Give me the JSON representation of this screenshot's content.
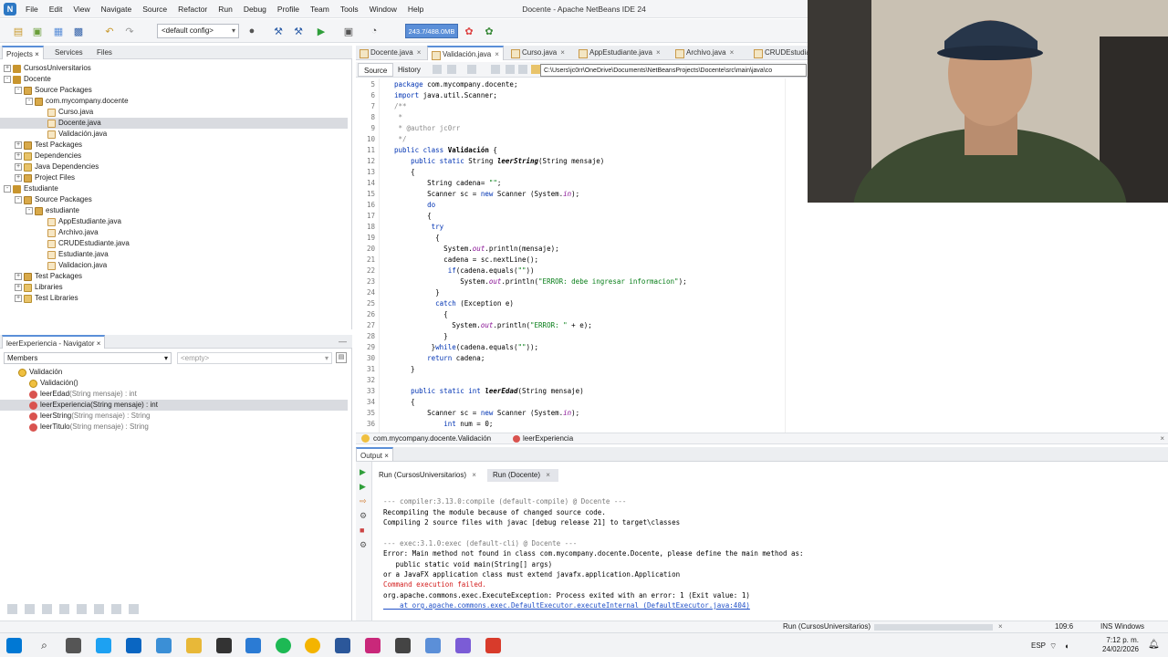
{
  "window": {
    "title": "Docente - Apache NetBeans IDE 24",
    "menu": [
      "File",
      "Edit",
      "View",
      "Navigate",
      "Source",
      "Refactor",
      "Run",
      "Debug",
      "Profile",
      "Team",
      "Tools",
      "Window",
      "Help"
    ]
  },
  "toolbar": {
    "config": "<default config>",
    "memory": "243.7/488.0MB"
  },
  "projects_panel": {
    "tabs": [
      "Projects",
      "Services",
      "Files"
    ],
    "tree": [
      {
        "label": "CursosUniversitarios",
        "level": 0,
        "icon": "project-icon"
      },
      {
        "label": "Docente",
        "level": 0,
        "icon": "project-icon"
      },
      {
        "label": "Source Packages",
        "level": 1,
        "icon": "package-folder-icon"
      },
      {
        "label": "com.mycompany.docente",
        "level": 2,
        "icon": "package-icon"
      },
      {
        "label": "Curso.java",
        "level": 3,
        "icon": "java-file-icon"
      },
      {
        "label": "Docente.java",
        "level": 3,
        "icon": "java-file-icon",
        "selected": true
      },
      {
        "label": "Validación.java",
        "level": 3,
        "icon": "java-file-icon"
      },
      {
        "label": "Test Packages",
        "level": 1,
        "icon": "package-folder-icon"
      },
      {
        "label": "Dependencies",
        "level": 1,
        "icon": "library-icon"
      },
      {
        "label": "Java Dependencies",
        "level": 1,
        "icon": "library-icon"
      },
      {
        "label": "Project Files",
        "level": 1,
        "icon": "folder-icon"
      },
      {
        "label": "Estudiante",
        "level": 0,
        "icon": "project-icon"
      },
      {
        "label": "Source Packages",
        "level": 1,
        "icon": "package-folder-icon"
      },
      {
        "label": "estudiante",
        "level": 2,
        "icon": "package-icon"
      },
      {
        "label": "AppEstudiante.java",
        "level": 3,
        "icon": "java-file-icon"
      },
      {
        "label": "Archivo.java",
        "level": 3,
        "icon": "java-file-icon"
      },
      {
        "label": "CRUDEstudiante.java",
        "level": 3,
        "icon": "java-file-icon"
      },
      {
        "label": "Estudiante.java",
        "level": 3,
        "icon": "java-file-icon"
      },
      {
        "label": "Validacion.java",
        "level": 3,
        "icon": "java-file-icon"
      },
      {
        "label": "Test Packages",
        "level": 1,
        "icon": "package-folder-icon"
      },
      {
        "label": "Libraries",
        "level": 1,
        "icon": "library-icon"
      },
      {
        "label": "Test Libraries",
        "level": 1,
        "icon": "library-icon"
      }
    ]
  },
  "navigator": {
    "title": "leerExperiencia - Navigator",
    "filter": "Members",
    "empty": "<empty>",
    "items": [
      {
        "label": "Validación",
        "detail": "",
        "level": 0,
        "icon": "class-icon"
      },
      {
        "label": "Validación()",
        "detail": "",
        "level": 1,
        "icon": "constructor-icon"
      },
      {
        "label": "leerEdad",
        "detail": "(String mensaje) : int",
        "level": 1,
        "icon": "method-icon"
      },
      {
        "label": "leerExperiencia(String mensaje) : int",
        "detail": "",
        "level": 1,
        "icon": "method-icon",
        "selected": true
      },
      {
        "label": "leerString",
        "detail": "(String mensaje) : String",
        "level": 1,
        "icon": "method-icon"
      },
      {
        "label": "leerTitulo",
        "detail": "(String mensaje) : String",
        "level": 1,
        "icon": "method-icon"
      }
    ]
  },
  "editor": {
    "tabs": [
      "Docente.java",
      "Validación.java",
      "Curso.java",
      "AppEstudiante.java",
      "Archivo.java",
      "CRUDEstudia"
    ],
    "active_tab": "Validación.java",
    "source_label": "Source",
    "history_label": "History",
    "tooltip": "C:\\Users\\jc0rr\\OneDrive\\Documents\\NetBeansProjects\\Docente\\src\\main\\java\\co",
    "line_numbers": [
      "5",
      "6",
      "7",
      "8",
      "9",
      "10",
      "11",
      "12",
      "13",
      "14",
      "15",
      "16",
      "17",
      "18",
      "19",
      "20",
      "21",
      "22",
      "23",
      "24",
      "25",
      "26",
      "27",
      "28",
      "29",
      "30",
      "31",
      "32",
      "33",
      "34",
      "35",
      "36"
    ],
    "breadcrumb": [
      "com.mycompany.docente.Validación",
      "leerExperiencia"
    ]
  },
  "output": {
    "title": "Output",
    "tabs": [
      "Run (CursosUniversitarios)",
      "Run (Docente)"
    ],
    "lines": [
      {
        "text": "--- compiler:3.13.0:compile (default-compile) @ Docente ---",
        "style": "gray"
      },
      {
        "text": "Recompiling the module because of changed source code.",
        "style": ""
      },
      {
        "text": "Compiling 2 source files with javac [debug release 21] to target\\classes",
        "style": ""
      },
      {
        "text": "",
        "style": ""
      },
      {
        "text": "--- exec:3.1.0:exec (default-cli) @ Docente ---",
        "style": "gray"
      },
      {
        "text": "Error: Main method not found in class com.mycompany.docente.Docente, please define the main method as:",
        "style": ""
      },
      {
        "text": "   public static void main(String[] args)",
        "style": ""
      },
      {
        "text": "or a JavaFX application class must extend javafx.application.Application",
        "style": ""
      },
      {
        "text": "Command execution failed.",
        "style": "red"
      },
      {
        "text": "org.apache.commons.exec.ExecuteException: Process exited with an error: 1 (Exit value: 1)",
        "style": ""
      },
      {
        "text": "    at org.apache.commons.exec.DefaultExecutor.executeInternal (DefaultExecutor.java:404)",
        "style": "link"
      }
    ]
  },
  "statusbar": {
    "run": "Run (CursosUniversitarios)",
    "position": "109:6",
    "mode": "INS Windows (CRLF)"
  },
  "taskbar": {
    "time": "7:12 p. m.",
    "date": "24/02/2026",
    "lang": "ESP"
  }
}
